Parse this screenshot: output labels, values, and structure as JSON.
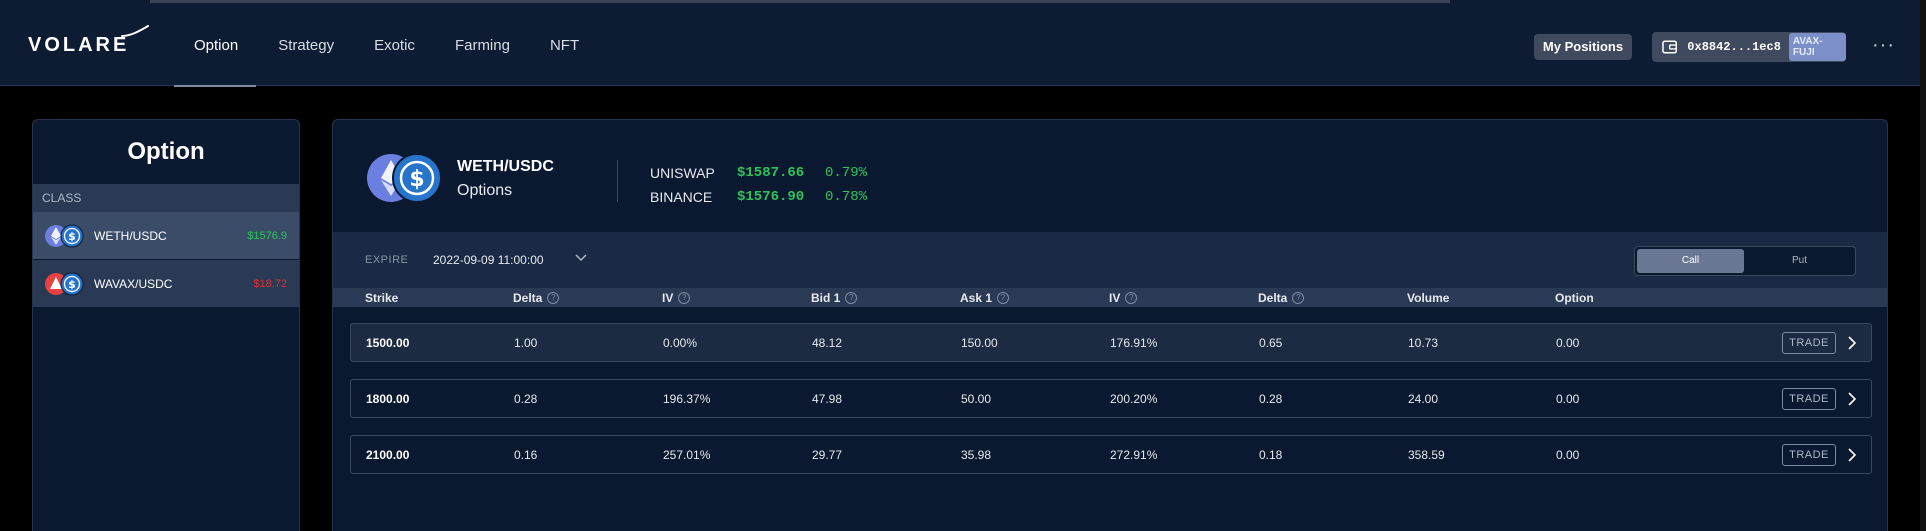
{
  "brand": {
    "logo": "VOLARE"
  },
  "nav": [
    {
      "label": "Option",
      "active": true
    },
    {
      "label": "Strategy",
      "active": false
    },
    {
      "label": "Exotic",
      "active": false
    },
    {
      "label": "Farming",
      "active": false
    },
    {
      "label": "NFT",
      "active": false
    }
  ],
  "header": {
    "my_positions": "My Positions",
    "wallet_address": "0x8842...1ec8",
    "network": "AVAX-FUJI",
    "more": "···"
  },
  "sidebar": {
    "title": "Option",
    "class_label": "CLASS",
    "pairs": [
      {
        "name": "WETH/USDC",
        "price": "$1576.9",
        "price_color": "#2bc45b",
        "selected": true
      },
      {
        "name": "WAVAX/USDC",
        "price": "$18.72",
        "price_color": "#d6343a",
        "selected": false
      }
    ]
  },
  "main": {
    "pair": "WETH/USDC",
    "subtitle": "Options",
    "venues": [
      {
        "name": "UNISWAP",
        "price": "$1587.66",
        "change": "0.79%"
      },
      {
        "name": "BINANCE",
        "price": "$1576.90",
        "change": "0.78%"
      }
    ],
    "expire_label": "EXPIRE",
    "expire_value": "2022-09-09 11:00:00",
    "toggle": {
      "call": "Call",
      "put": "Put",
      "selected": "Call"
    },
    "columns": [
      "Strike",
      "Delta",
      "IV",
      "Bid 1",
      "Ask 1",
      "IV",
      "Delta",
      "Volume",
      "Option"
    ],
    "trade_label": "TRADE",
    "rows": [
      {
        "strike": "1500.00",
        "delta": "1.00",
        "iv": "0.00%",
        "bid": "48.12",
        "ask": "150.00",
        "iv2": "176.91%",
        "delta2": "0.65",
        "volume": "10.73",
        "option": "0.00"
      },
      {
        "strike": "1800.00",
        "delta": "0.28",
        "iv": "196.37%",
        "bid": "47.98",
        "ask": "50.00",
        "iv2": "200.20%",
        "delta2": "0.28",
        "volume": "24.00",
        "option": "0.00"
      },
      {
        "strike": "2100.00",
        "delta": "0.16",
        "iv": "257.01%",
        "bid": "29.77",
        "ask": "35.98",
        "iv2": "272.91%",
        "delta2": "0.18",
        "volume": "358.59",
        "option": "0.00"
      }
    ]
  },
  "colors": {
    "background": "#0b1930",
    "header": "#0d1b33",
    "positive": "#2bc45b",
    "negative": "#d6343a",
    "eth": "#6b7fe0",
    "usdc": "#2775ca",
    "avax": "#e84142"
  }
}
